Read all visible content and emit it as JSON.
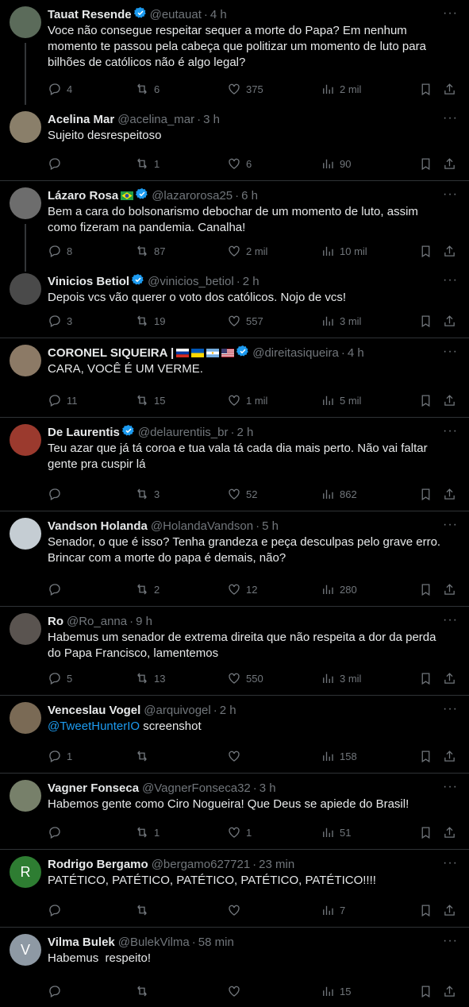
{
  "tweets": [
    {
      "name": "Tauat Resende",
      "verified": true,
      "handle": "@eutauat",
      "time": "4 h",
      "lines": [
        "Voce não consegue respeitar sequer a morte do Papa? Em nenhum",
        "momento te passou pela cabeça que politizar um momento de luto para",
        "bilhões de católicos não é algo legal?"
      ],
      "replies": "4",
      "retweets": "6",
      "likes": "375",
      "views": "2 mil",
      "avatar": "#5b6b5a"
    },
    {
      "name": "Acelina Mar",
      "verified": false,
      "handle": "@acelina_mar",
      "time": "3 h",
      "lines": [
        "Sujeito desrespeitoso"
      ],
      "replies": "",
      "retweets": "1",
      "likes": "6",
      "views": "90",
      "avatar": "#8a7f6a"
    },
    {
      "name": "Lázaro Rosa",
      "flag": "🇧🇷",
      "verified": true,
      "handle": "@lazarorosa25",
      "time": "6 h",
      "lines": [
        "Bem a cara do bolsonarismo debochar de um momento de luto, assim",
        "como fizeram na pandemia. Canalha!"
      ],
      "replies": "8",
      "retweets": "87",
      "likes": "2 mil",
      "views": "10 mil",
      "avatar": "#6d6d6d"
    },
    {
      "name": "Vinicios Betiol",
      "verified": true,
      "handle": "@vinicios_betiol",
      "time": "2 h",
      "lines": [
        "Depois vcs vão querer o voto dos católicos. Nojo de vcs!"
      ],
      "replies": "3",
      "retweets": "19",
      "likes": "557",
      "views": "3 mil",
      "avatar": "#4a4a4a"
    },
    {
      "name": "CORONEL SIQUEIRA |",
      "flags": [
        "🇷🇺",
        "🇺🇦",
        "🇦🇷",
        "🇺🇸"
      ],
      "verified": true,
      "handle": "@direitasiqueira",
      "time": "4 h",
      "lines": [
        "CARA, VOCÊ É UM VERME."
      ],
      "replies": "11",
      "retweets": "15",
      "likes": "1 mil",
      "views": "5 mil",
      "avatar": "#8c7a66"
    },
    {
      "name": "De Laurentis",
      "verified": true,
      "handle": "@delaurentiis_br",
      "time": "2 h",
      "lines": [
        "Teu azar que já tá coroa e tua vala tá cada dia mais perto. Não vai faltar",
        "gente pra cuspir lá"
      ],
      "replies": "",
      "retweets": "3",
      "likes": "52",
      "views": "862",
      "avatar": "#9b3a2e"
    },
    {
      "name": "Vandson Holanda",
      "verified": false,
      "handle": "@HolandaVandson",
      "time": "5 h",
      "lines": [
        "Senador, o que é isso? Tenha grandeza e peça desculpas pelo grave erro.",
        "Brincar com a morte do papa é demais, não?"
      ],
      "replies": "",
      "retweets": "2",
      "likes": "12",
      "views": "280",
      "avatar": "#c5cdd3"
    },
    {
      "name": "Ro",
      "verified": false,
      "handle": "@Ro_anna",
      "time": "9 h",
      "lines": [
        "Habemus um senador de extrema direita que não respeita a dor da perda",
        "do Papa Francisco, lamentemos"
      ],
      "replies": "5",
      "retweets": "13",
      "likes": "550",
      "views": "3 mil",
      "avatar": "#5a5450"
    },
    {
      "name": "Venceslau Vogel",
      "verified": false,
      "handle": "@arquivogel",
      "time": "2 h",
      "mention": "@TweetHunterIO",
      "lines": [
        "screenshot"
      ],
      "replies": "1",
      "retweets": "",
      "likes": "",
      "views": "158",
      "avatar": "#7a6a55"
    },
    {
      "name": "Vagner Fonseca",
      "verified": false,
      "handle": "@VagnerFonseca32",
      "time": "3 h",
      "lines": [
        "Habemos gente como Ciro Nogueira! Que Deus se apiede do Brasil!"
      ],
      "replies": "",
      "retweets": "1",
      "likes": "1",
      "views": "51",
      "avatar": "#77806a"
    },
    {
      "name": "Rodrigo Bergamo",
      "verified": false,
      "handle": "@bergamo627721",
      "time": "23 min",
      "lines": [
        "PATÉTICO, PATÉTICO, PATÉTICO, PATÉTICO, PATÉTICO!!!!"
      ],
      "replies": "",
      "retweets": "",
      "likes": "",
      "views": "7",
      "avatar": "#2e7d32",
      "initial": "R"
    },
    {
      "name": "Vilma Bulek",
      "verified": false,
      "handle": "@BulekVilma",
      "time": "58 min",
      "lines": [
        "Habemus  respeito!"
      ],
      "replies": "",
      "retweets": "",
      "likes": "",
      "views": "15",
      "avatar": "#8e99a4",
      "initial": "V"
    }
  ],
  "colors": {
    "accent": "#1d9bf0",
    "muted": "#71767b",
    "text": "#e7e9ea",
    "border": "#2f3336"
  }
}
